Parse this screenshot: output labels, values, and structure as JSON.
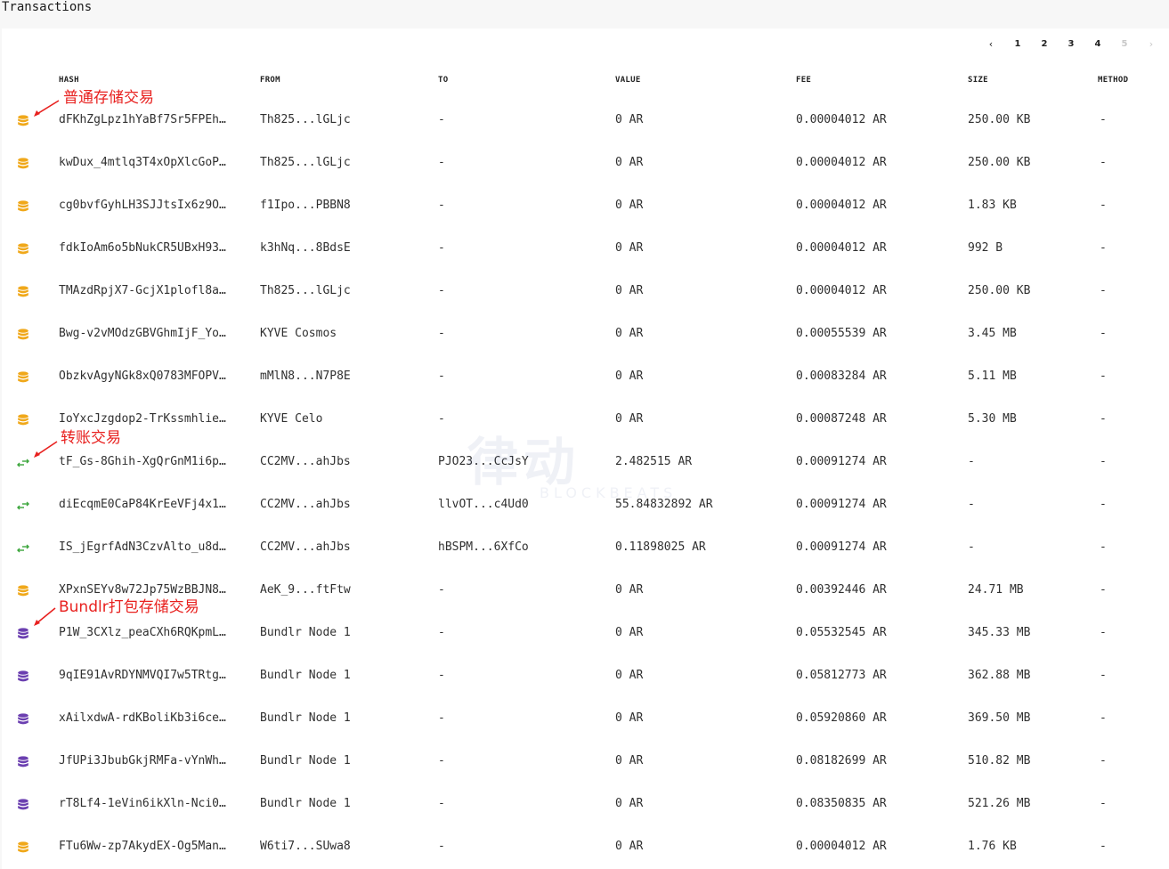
{
  "page": {
    "title": "Transactions"
  },
  "pagination": {
    "prev_icon": "chevron-left-icon",
    "next_icon": "chevron-right-icon",
    "prev": "‹",
    "next": "›",
    "pages": [
      "1",
      "2",
      "3",
      "4",
      "5"
    ],
    "disabled_page": "5"
  },
  "columns": {
    "hash": "HASH",
    "from": "FROM",
    "to": "TO",
    "value": "VALUE",
    "fee": "FEE",
    "size": "SIZE",
    "method": "METHOD"
  },
  "colors": {
    "storage": "#f0a81a",
    "transfer": "#3aa53a",
    "bundle": "#6b3fb0",
    "annotation": "#e8211f"
  },
  "annotations": {
    "storage": "普通存储交易",
    "transfer": "转账交易",
    "bundle": "Bundlr打包存储交易"
  },
  "rows": [
    {
      "type": "storage",
      "icon": "database-icon",
      "hash": "dFKhZgLpz1hYaBf7Sr5FPEh…",
      "from": "Th825...lGLjc",
      "to": "-",
      "value": "0 AR",
      "fee": "0.00004012 AR",
      "size": "250.00 KB",
      "method": "-"
    },
    {
      "type": "storage",
      "icon": "database-icon",
      "hash": "kwDux_4mtlq3T4xOpXlcGoP…",
      "from": "Th825...lGLjc",
      "to": "-",
      "value": "0 AR",
      "fee": "0.00004012 AR",
      "size": "250.00 KB",
      "method": "-"
    },
    {
      "type": "storage",
      "icon": "database-icon",
      "hash": "cg0bvfGyhLH3SJJtsIx6z9O…",
      "from": "f1Ipo...PBBN8",
      "to": "-",
      "value": "0 AR",
      "fee": "0.00004012 AR",
      "size": "1.83 KB",
      "method": "-"
    },
    {
      "type": "storage",
      "icon": "database-icon",
      "hash": "fdkIoAm6o5bNukCR5UBxH93…",
      "from": "k3hNq...8BdsE",
      "to": "-",
      "value": "0 AR",
      "fee": "0.00004012 AR",
      "size": "992 B",
      "method": "-"
    },
    {
      "type": "storage",
      "icon": "database-icon",
      "hash": "TMAzdRpjX7-GcjX1plofl8a…",
      "from": "Th825...lGLjc",
      "to": "-",
      "value": "0 AR",
      "fee": "0.00004012 AR",
      "size": "250.00 KB",
      "method": "-"
    },
    {
      "type": "storage",
      "icon": "database-icon",
      "hash": "Bwg-v2vMOdzGBVGhmIjF_Yo…",
      "from": "KYVE Cosmos",
      "to": "-",
      "value": "0 AR",
      "fee": "0.00055539 AR",
      "size": "3.45 MB",
      "method": "-"
    },
    {
      "type": "storage",
      "icon": "database-icon",
      "hash": "ObzkvAgyNGk8xQ0783MFOPV…",
      "from": "mMlN8...N7P8E",
      "to": "-",
      "value": "0 AR",
      "fee": "0.00083284 AR",
      "size": "5.11 MB",
      "method": "-"
    },
    {
      "type": "storage",
      "icon": "database-icon",
      "hash": "IoYxcJzgdop2-TrKssmhlie…",
      "from": "KYVE Celo",
      "to": "-",
      "value": "0 AR",
      "fee": "0.00087248 AR",
      "size": "5.30 MB",
      "method": "-"
    },
    {
      "type": "transfer",
      "icon": "transfer-arrows-icon",
      "hash": "tF_Gs-8Ghih-XgQrGnM1i6p…",
      "from": "CC2MV...ahJbs",
      "to": "PJO23...CcJsY",
      "value": "2.482515 AR",
      "fee": "0.00091274 AR",
      "size": "-",
      "method": "-"
    },
    {
      "type": "transfer",
      "icon": "transfer-arrows-icon",
      "hash": "diEcqmE0CaP84KrEeVFj4x1…",
      "from": "CC2MV...ahJbs",
      "to": "llvOT...c4Ud0",
      "value": "55.84832892 AR",
      "fee": "0.00091274 AR",
      "size": "-",
      "method": "-"
    },
    {
      "type": "transfer",
      "icon": "transfer-arrows-icon",
      "hash": "IS_jEgrfAdN3CzvAlto_u8d…",
      "from": "CC2MV...ahJbs",
      "to": "hBSPM...6XfCo",
      "value": "0.11898025 AR",
      "fee": "0.00091274 AR",
      "size": "-",
      "method": "-"
    },
    {
      "type": "storage",
      "icon": "database-icon",
      "hash": "XPxnSEYv8w72Jp75WzBBJN8…",
      "from": "AeK_9...ftFtw",
      "to": "-",
      "value": "0 AR",
      "fee": "0.00392446 AR",
      "size": "24.71 MB",
      "method": "-"
    },
    {
      "type": "bundle",
      "icon": "database-icon",
      "hash": "P1W_3CXlz_peaCXh6RQKpmL…",
      "from": "Bundlr Node 1",
      "to": "-",
      "value": "0 AR",
      "fee": "0.05532545 AR",
      "size": "345.33 MB",
      "method": "-"
    },
    {
      "type": "bundle",
      "icon": "database-icon",
      "hash": "9qIE91AvRDYNMVQI7w5TRtg…",
      "from": "Bundlr Node 1",
      "to": "-",
      "value": "0 AR",
      "fee": "0.05812773 AR",
      "size": "362.88 MB",
      "method": "-"
    },
    {
      "type": "bundle",
      "icon": "database-icon",
      "hash": "xAilxdwA-rdKBoliKb3i6ce…",
      "from": "Bundlr Node 1",
      "to": "-",
      "value": "0 AR",
      "fee": "0.05920860 AR",
      "size": "369.50 MB",
      "method": "-"
    },
    {
      "type": "bundle",
      "icon": "database-icon",
      "hash": "JfUPi3JbubGkjRMFa-vYnWh…",
      "from": "Bundlr Node 1",
      "to": "-",
      "value": "0 AR",
      "fee": "0.08182699 AR",
      "size": "510.82 MB",
      "method": "-"
    },
    {
      "type": "bundle",
      "icon": "database-icon",
      "hash": "rT8Lf4-1eVin6ikXln-Nci0…",
      "from": "Bundlr Node 1",
      "to": "-",
      "value": "0 AR",
      "fee": "0.08350835 AR",
      "size": "521.26 MB",
      "method": "-"
    },
    {
      "type": "storage",
      "icon": "database-icon",
      "hash": "FTu6Ww-zp7AkydEX-Og5Man…",
      "from": "W6ti7...SUwa8",
      "to": "-",
      "value": "0 AR",
      "fee": "0.00004012 AR",
      "size": "1.76 KB",
      "method": "-"
    }
  ],
  "watermark": {
    "logo": "律动",
    "sub": "BLOCKBEATS"
  }
}
